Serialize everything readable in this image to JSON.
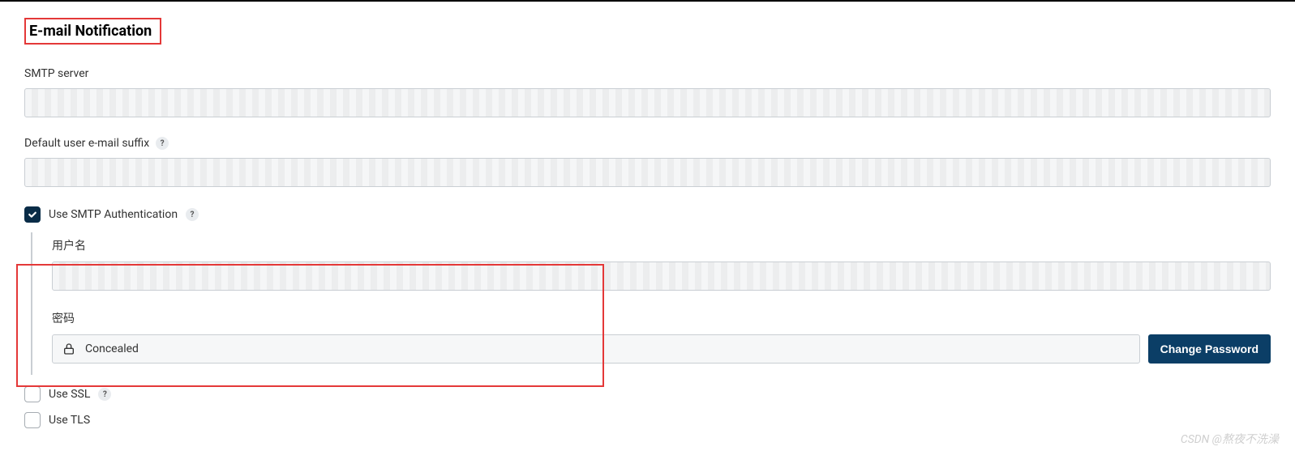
{
  "section": {
    "title": "E-mail Notification"
  },
  "smtp": {
    "label": "SMTP server",
    "value": ""
  },
  "default_suffix": {
    "label": "Default user e-mail suffix",
    "value": ""
  },
  "use_smtp_auth": {
    "label": "Use SMTP Authentication",
    "checked": true
  },
  "auth": {
    "username_label": "用户名",
    "username_value": "",
    "password_label": "密码",
    "password_state": "Concealed",
    "change_password_btn": "Change Password"
  },
  "use_ssl": {
    "label": "Use SSL",
    "checked": false
  },
  "use_tls": {
    "label": "Use TLS",
    "checked": false
  },
  "watermark": "CSDN @熬夜不洗澡"
}
